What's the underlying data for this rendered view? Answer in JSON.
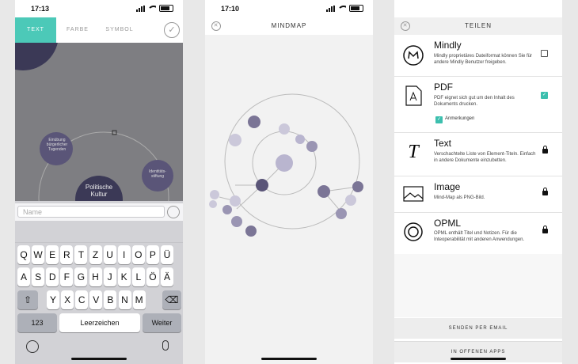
{
  "phone1": {
    "time": "17:13",
    "tabs": [
      "TEXT",
      "FARBE",
      "SYMBOL"
    ],
    "nodes": {
      "einübung": "Einübung bürgerlicher Tugenden",
      "politische": "Politische Kultur",
      "identitaet": "Identitäts-stiftung"
    },
    "name_placeholder": "Name",
    "keys_row1": [
      "Q",
      "W",
      "E",
      "R",
      "T",
      "Z",
      "U",
      "I",
      "O",
      "P",
      "Ü"
    ],
    "keys_row2": [
      "A",
      "S",
      "D",
      "F",
      "G",
      "H",
      "J",
      "K",
      "L",
      "Ö",
      "Ä"
    ],
    "keys_row3": [
      "Y",
      "X",
      "C",
      "V",
      "B",
      "N",
      "M"
    ],
    "key_numbers": "123",
    "key_space": "Leerzeichen",
    "key_next": "Weiter"
  },
  "phone2": {
    "time": "17:10",
    "title": "MINDMAP"
  },
  "phone3": {
    "title": "TEILEN",
    "options": [
      {
        "title": "Mindly",
        "desc": "Mindly proprietäres Dateiformat können Sie für andere Mindly Benutzer freigeben."
      },
      {
        "title": "PDF",
        "desc": "PDF eignet sich gut um den Inhalt des Dokuments drucken."
      },
      {
        "title": "Text",
        "desc": "Verschachtelte Liste von Element-Titeln. Einfach in andere Dokumente einzubetten."
      },
      {
        "title": "Image",
        "desc": "Mind-Map als PNG-Bild."
      },
      {
        "title": "OPML",
        "desc": "OPML enthält Titel und Notizen. Für die Inteoperabilität mit anderen Anwendungen."
      }
    ],
    "annotations_label": "Anmerkungen",
    "email_button": "SENDEN PER EMAIL",
    "open_in_apps": "IN OFFENEN APPS"
  }
}
